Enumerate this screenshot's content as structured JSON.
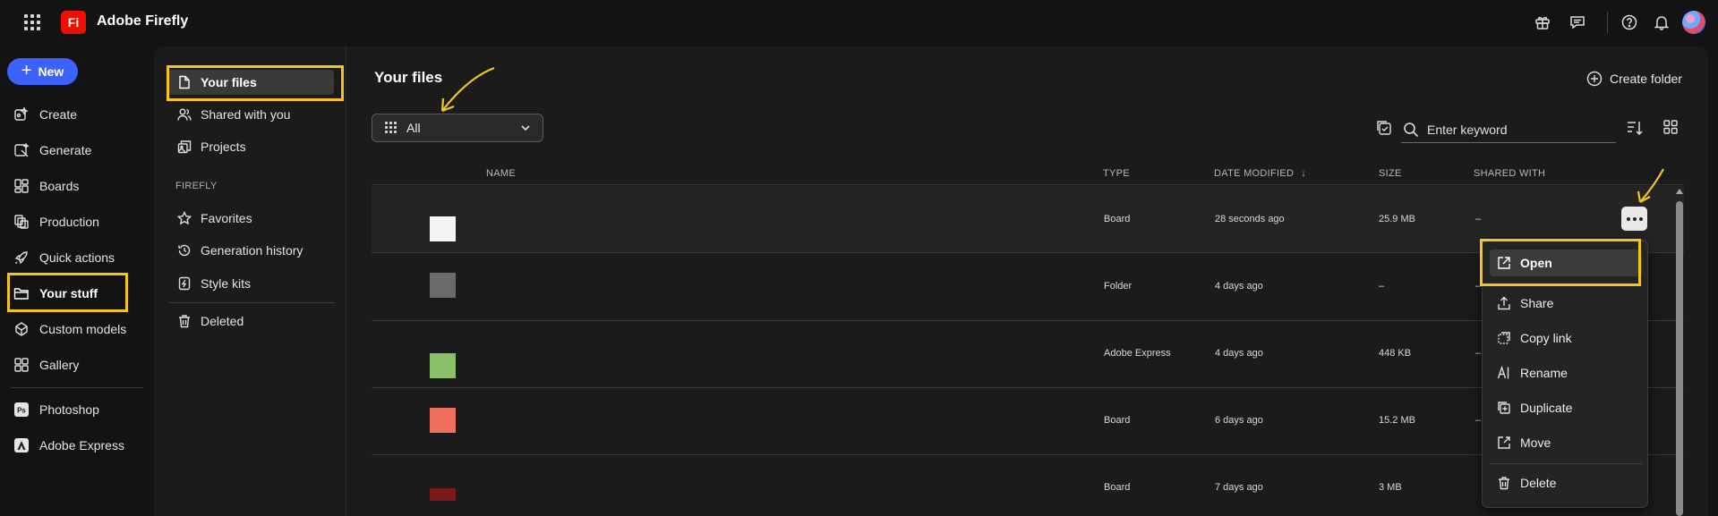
{
  "app": {
    "logo_text": "Fi",
    "title": "Adobe Firefly"
  },
  "nav": {
    "new_label": "New",
    "items": [
      {
        "label": "Create",
        "icon": "create-icon"
      },
      {
        "label": "Generate",
        "icon": "generate-icon"
      },
      {
        "label": "Boards",
        "icon": "boards-icon"
      },
      {
        "label": "Production",
        "icon": "production-icon"
      },
      {
        "label": "Quick actions",
        "icon": "rocket-icon"
      },
      {
        "label": "Your stuff",
        "icon": "folder-icon"
      },
      {
        "label": "Custom models",
        "icon": "custom-models-icon"
      },
      {
        "label": "Gallery",
        "icon": "gallery-icon"
      }
    ],
    "apps": [
      {
        "label": "Photoshop",
        "icon": "photoshop-icon"
      },
      {
        "label": "Adobe Express",
        "icon": "adobe-express-icon"
      }
    ]
  },
  "subnav": {
    "your_files": "Your files",
    "shared_with_you": "Shared with you",
    "projects": "Projects",
    "section": "FIREFLY",
    "favorites": "Favorites",
    "generation_history": "Generation history",
    "style_kits": "Style kits",
    "deleted": "Deleted"
  },
  "main": {
    "title": "Your files",
    "create_folder": "Create folder",
    "filter_value": "All",
    "search_placeholder": "Enter keyword"
  },
  "table": {
    "headers": {
      "name": "NAME",
      "type": "TYPE",
      "date_modified": "DATE MODIFIED",
      "size": "SIZE",
      "shared_with": "SHARED WITH"
    },
    "rows": [
      {
        "type": "Board",
        "date": "28 seconds ago",
        "size": "25.9 MB",
        "shared": "–",
        "thumb_color": "#f5f5f5"
      },
      {
        "type": "Folder",
        "date": "4 days ago",
        "size": "–",
        "shared": "–",
        "thumb_color": "#6a6a6a"
      },
      {
        "type": "Adobe Express",
        "date": "4 days ago",
        "size": "448 KB",
        "shared": "–",
        "thumb_color": "#8cbf6a"
      },
      {
        "type": "Board",
        "date": "6 days ago",
        "size": "15.2 MB",
        "shared": "–",
        "thumb_color": "#f07060"
      },
      {
        "type": "Board",
        "date": "7 days ago",
        "size": "3 MB",
        "shared": "–",
        "thumb_color": "#7a1a1a"
      }
    ]
  },
  "context_menu": {
    "open": "Open",
    "share": "Share",
    "copy_link": "Copy link",
    "rename": "Rename",
    "duplicate": "Duplicate",
    "move": "Move",
    "delete": "Delete"
  },
  "colors": {
    "accent": "#3b63fb",
    "highlight": "#f5c518",
    "logo": "#eb1000"
  }
}
